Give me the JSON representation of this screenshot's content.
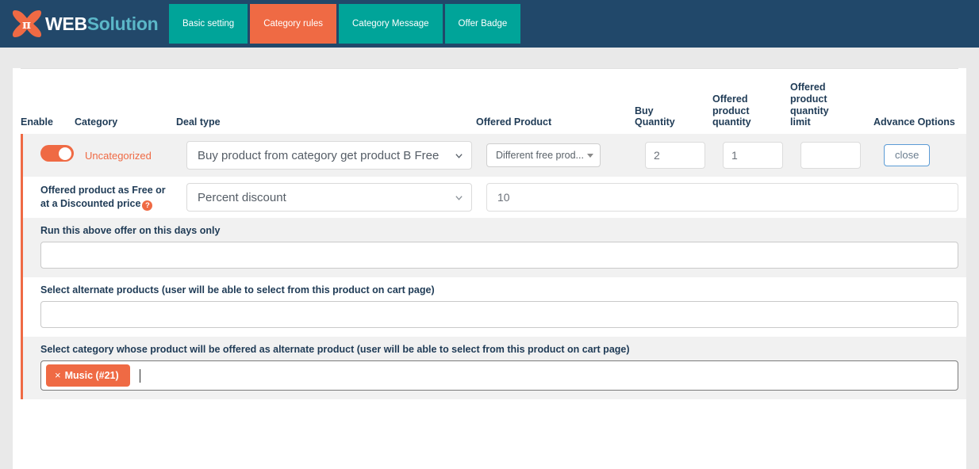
{
  "header": {
    "brand": {
      "web": "WEB",
      "solution": "Solution",
      "logo_icon": "x-pi-logo-icon"
    },
    "tabs": [
      {
        "label": "Basic setting",
        "active": false
      },
      {
        "label": "Category rules",
        "active": true
      },
      {
        "label": "Category Message",
        "active": false
      },
      {
        "label": "Offer Badge",
        "active": false
      }
    ],
    "colors": {
      "bar": "#21486a",
      "tab": "#00a499",
      "tab_active": "#ef6a44"
    }
  },
  "table": {
    "headers": {
      "enable": "Enable",
      "category": "Category",
      "deal_type": "Deal type",
      "offered_product": "Offered Product",
      "buy_quantity": "Buy\nQuantity",
      "buy_quantity_l1": "Buy",
      "buy_quantity_l2": "Quantity",
      "offered_product_quantity_l1": "Offered",
      "offered_product_quantity_l2": "product",
      "offered_product_quantity_l3": "quantity",
      "offered_product_quantity_limit_l1": "Offered",
      "offered_product_quantity_limit_l2": "product",
      "offered_product_quantity_limit_l3": "quantity",
      "offered_product_quantity_limit_l4": "limit",
      "advance_options": "Advance Options"
    },
    "row": {
      "enabled": true,
      "category": "Uncategorized",
      "deal_type_value": "Buy product from category get product B Free",
      "offered_product_value": "Different free prod...",
      "buy_quantity_value": "2",
      "offered_product_quantity_value": "1",
      "offered_product_quantity_limit_value": "",
      "advance_options_button": "close"
    }
  },
  "discount": {
    "label_line1": "Offered product as Free or",
    "label_line2": "at a Discounted price",
    "help_icon": "?",
    "type_value": "Percent discount",
    "amount_value": "10"
  },
  "blocks": [
    {
      "label": "Run this above offer on this days only",
      "value": ""
    },
    {
      "label": "Select alternate products (user will be able to select from this product on cart page)",
      "value": ""
    }
  ],
  "category_block": {
    "label": "Select category whose product will be offered as alternate product (user will be able to select from this product on cart page)",
    "tags": [
      {
        "remove": "×",
        "label": "Music (#21)"
      }
    ]
  },
  "accent_colors": {
    "orange": "#ef6a44",
    "teal": "#00a499",
    "navy": "#21486a",
    "blue_border": "#5b9bd5"
  }
}
